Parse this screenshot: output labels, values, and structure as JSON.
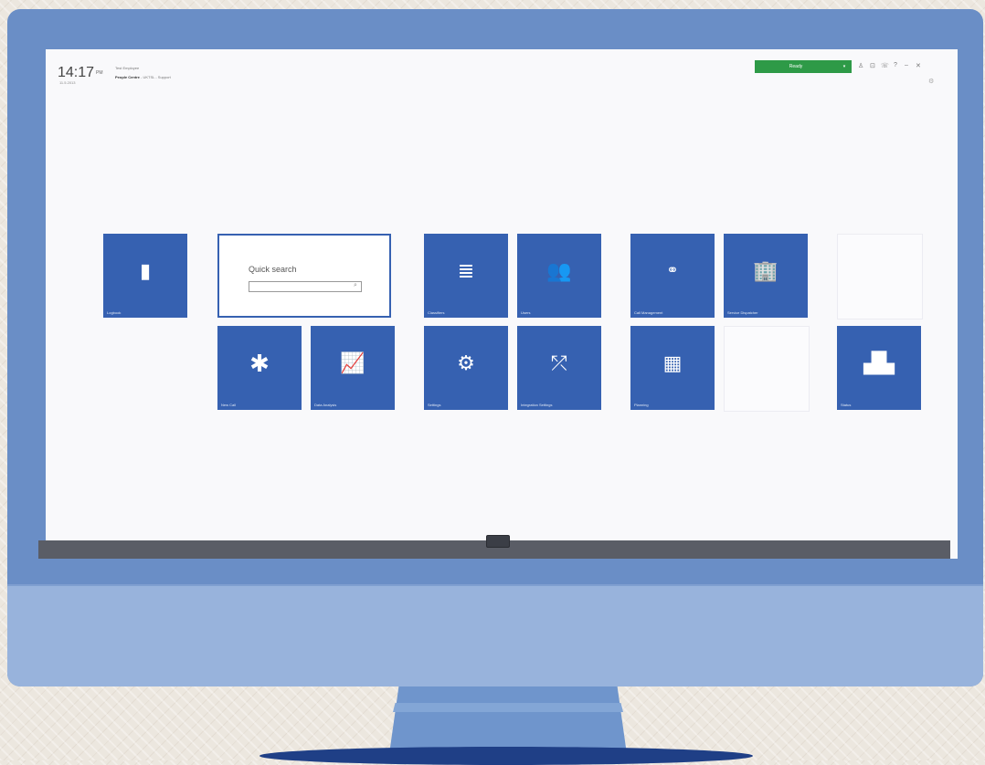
{
  "header": {
    "time": "14:17",
    "ampm": "PM",
    "date": "11.5.2013",
    "user": "Test Employee",
    "breadcrumb_bold": "People Centre",
    "breadcrumb_rest": "- UKTSL - Support",
    "status": "Ready",
    "status_arrow": "▾"
  },
  "search": {
    "title": "Quick search",
    "placeholder": ""
  },
  "tiles": {
    "logbook": "Logbook",
    "new_call": "New Call",
    "data_analysis": "Data Analysis",
    "classifiers": "Classifiers",
    "users": "Users",
    "settings": "Settings",
    "integration_settings": "Integration Settings",
    "call_management": "Call Management",
    "service_dispatcher": "Service Dispatcher",
    "planning": "Planning",
    "status": "Status"
  },
  "colors": {
    "tile": "#3661b1",
    "status": "#2e9a47",
    "monitor": "#6a8ec6"
  }
}
